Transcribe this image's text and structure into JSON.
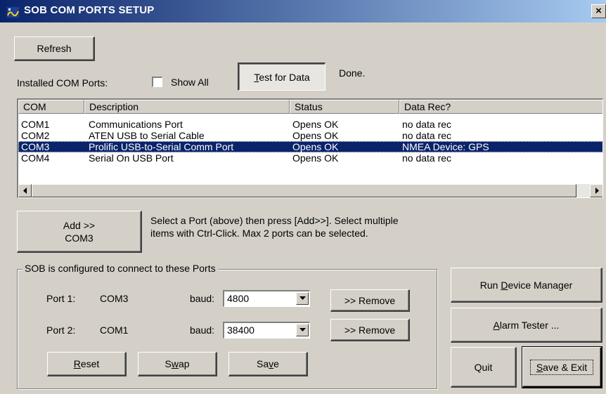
{
  "window": {
    "title": "SOB COM PORTS SETUP",
    "close_glyph": "×"
  },
  "toolbar": {
    "refresh": "Refresh",
    "installed_label": "Installed COM Ports:",
    "show_all": "Show All",
    "show_all_checked": false,
    "test_for_data_u": "T",
    "test_for_data_rest": "est for Data",
    "status": "Done."
  },
  "ports_table": {
    "columns": [
      "COM",
      "Description",
      "Status",
      "Data Rec?"
    ],
    "rows": [
      [
        "COM1",
        "Communications Port",
        "Opens OK",
        "no data rec"
      ],
      [
        "COM2",
        "ATEN USB to Serial Cable",
        "Opens OK",
        "no data rec"
      ],
      [
        "COM3",
        "Prolific USB-to-Serial Comm Port",
        "Opens OK",
        "NMEA Device: GPS"
      ],
      [
        "COM4",
        "Serial On USB Port",
        "Opens OK",
        "no data rec"
      ]
    ],
    "selected_row": 2
  },
  "add": {
    "line1": "Add >>",
    "line2": "COM3",
    "help_line1": "Select a Port (above) then press [Add>>]. Select multiple",
    "help_line2": "items with Ctrl-Click. Max 2 ports can be selected."
  },
  "config": {
    "group_title": "SOB is configured to connect to these Ports",
    "ports": [
      {
        "label": "Port 1:",
        "com": "COM3",
        "baud_label": "baud:",
        "baud": "4800",
        "remove": ">> Remove"
      },
      {
        "label": "Port 2:",
        "com": "COM1",
        "baud_label": "baud:",
        "baud": "38400",
        "remove": ">> Remove"
      }
    ],
    "reset_u": "R",
    "reset_rest": "eset",
    "swap_pre": "S",
    "swap_u": "w",
    "swap_rest": "ap",
    "save_pre": "Sa",
    "save_u": "v",
    "save_rest": "e"
  },
  "right": {
    "run_dm_pre": "Run ",
    "run_dm_u": "D",
    "run_dm_rest": "evice Manager",
    "alarm_u": "A",
    "alarm_rest": "larm Tester ...",
    "quit": "Quit",
    "save_exit_u": "S",
    "save_exit_rest": "ave & Exit"
  },
  "icons": {
    "app": "sob-app-icon",
    "dropdown": "chevron-down-icon",
    "scroll_left": "arrow-left-icon",
    "scroll_right": "arrow-right-icon"
  },
  "colors": {
    "title_start": "#0a246a",
    "title_end": "#a6caf0",
    "selection": "#0a246a",
    "face": "#d4d0c8"
  }
}
